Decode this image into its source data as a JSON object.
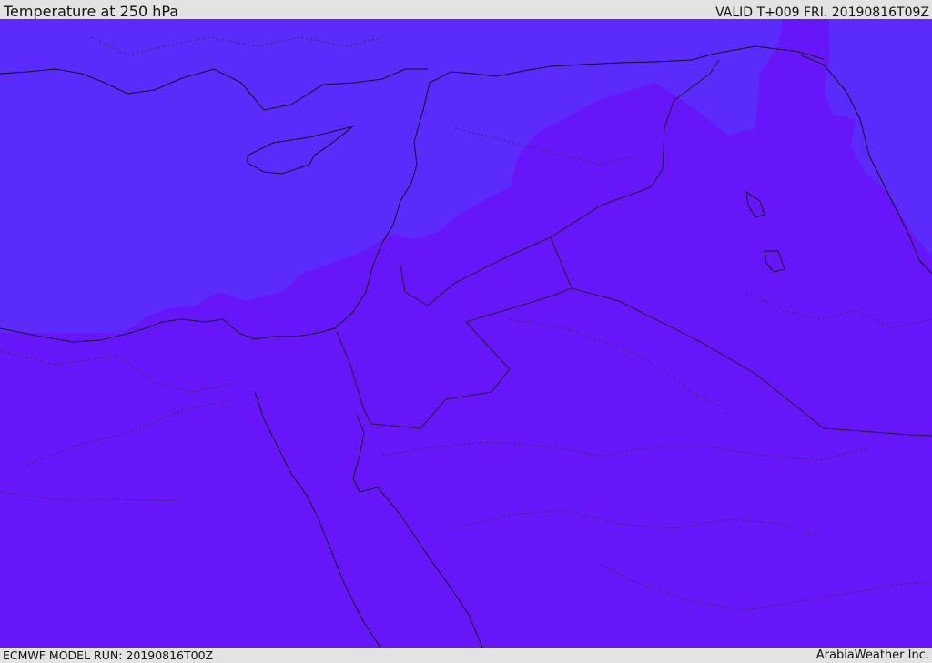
{
  "header": {
    "title": "Temperature at 250 hPa",
    "valid_time": "VALID T+009 FRI. 20190816T09Z"
  },
  "footer": {
    "model_run": "ECMWF MODEL RUN: 20190816T00Z",
    "credit": "ArabiaWeather Inc."
  },
  "map": {
    "fill_colors": {
      "warmer_band": "#6716f9",
      "cooler_band": "#5a2bfb",
      "coast_line": "#111111",
      "border_line": "#222222",
      "top_bar": "#e3e3e3"
    }
  }
}
